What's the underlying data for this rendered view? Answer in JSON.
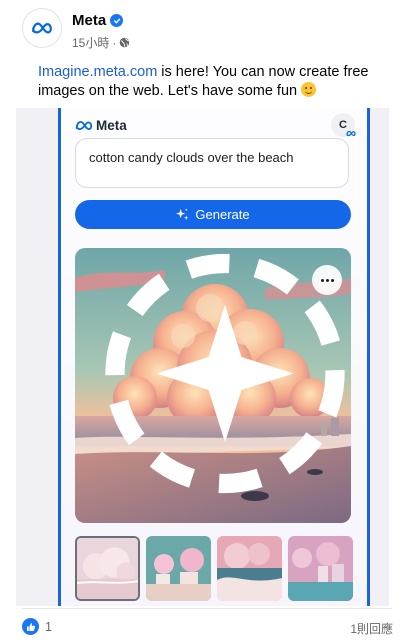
{
  "post": {
    "page_name": "Meta",
    "time": "15小時",
    "caption_link": "Imagine.meta.com",
    "caption_text": " is here! You can now create free images on the web. Let's have some fun "
  },
  "app": {
    "brand": "Meta",
    "user_initial": "C",
    "prompt": "cotton candy clouds over the beach",
    "generate_label": "Generate"
  },
  "footer": {
    "reaction_count": "1",
    "reply_count": "1則回應"
  },
  "colors": {
    "accent": "#1467e8",
    "frame": "#1a63d8",
    "link": "#1b5fcf"
  },
  "icons": [
    "meta-logo-icon",
    "verified-badge-icon",
    "globe-icon",
    "sparkle-icon",
    "more-icon",
    "animate-icon",
    "like-icon"
  ]
}
